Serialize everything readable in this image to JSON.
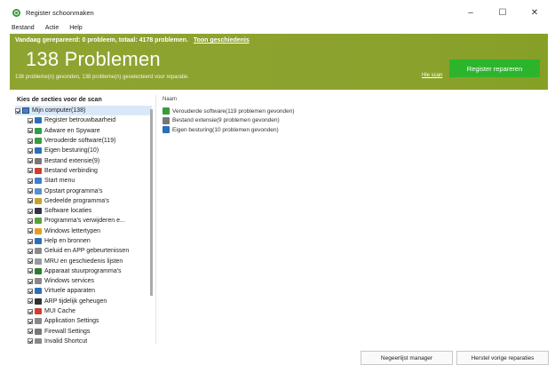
{
  "window": {
    "title": "Register schoonmaken",
    "controls": [
      "–",
      "☐",
      "✕"
    ]
  },
  "menu": [
    "Bestand",
    "Actie",
    "Help"
  ],
  "banner": {
    "summary": "Vandaag gerepareerd: 0 probleem, totaal: 4178 problemen.",
    "history_link": "Toon geschiedenis",
    "headline": "138 Problemen",
    "subtext": "138 probleme(n) gevonden, 138 probleme(n) geselecteerd voor reparatie.",
    "hide_scan": "Hie scan",
    "repair_button": "Register repareren",
    "color": "#8ba22d",
    "button_color": "#2cb52c"
  },
  "left_panel": {
    "header": "Kies de secties voor de scan",
    "root": {
      "label": "Mijn computer(138)",
      "icon": "computer-icon"
    },
    "items": [
      {
        "label": "Register betrouwbaarheid",
        "icon": "registry-icon",
        "color": "#2a6fb8"
      },
      {
        "label": "Adware en Spyware",
        "icon": "adware-icon",
        "color": "#2f9d4a"
      },
      {
        "label": "Verouderde software(119)",
        "icon": "software-icon",
        "color": "#3a9b3a"
      },
      {
        "label": "Eigen besturing(10)",
        "icon": "control-icon",
        "color": "#2a6fb8"
      },
      {
        "label": "Bestand extensie(9)",
        "icon": "file-icon",
        "color": "#777777"
      },
      {
        "label": "Bestand verbinding",
        "icon": "file-link-icon",
        "color": "#d23c2c"
      },
      {
        "label": "Start menu",
        "icon": "start-menu-icon",
        "color": "#3a7fd0"
      },
      {
        "label": "Opstart programma's",
        "icon": "startup-icon",
        "color": "#5a8fc7"
      },
      {
        "label": "Gedeelde programma's",
        "icon": "shared-icon",
        "color": "#c8a030"
      },
      {
        "label": "Software locaties",
        "icon": "location-icon",
        "color": "#334"
      },
      {
        "label": "Programma's verwijderen e...",
        "icon": "uninstall-icon",
        "color": "#5aa03a"
      },
      {
        "label": "Windows lettertypen",
        "icon": "font-icon",
        "color": "#e0a020"
      },
      {
        "label": "Help en bronnen",
        "icon": "help-icon",
        "color": "#2a6fb8"
      },
      {
        "label": "Geluid en APP gebeurtenissen",
        "icon": "sound-icon",
        "color": "#8a8a8a"
      },
      {
        "label": "MRU en geschiedenis lijsten",
        "icon": "history-icon",
        "color": "#999999"
      },
      {
        "label": "Apparaat stuurprogramma's",
        "icon": "driver-icon",
        "color": "#2f7a2f"
      },
      {
        "label": "Windows services",
        "icon": "services-icon",
        "color": "#888888"
      },
      {
        "label": "Virtuele apparaten",
        "icon": "virtual-icon",
        "color": "#2a6fb8"
      },
      {
        "label": "ARP tijdelijk geheugen",
        "icon": "arp-icon",
        "color": "#333333"
      },
      {
        "label": "MUI Cache",
        "icon": "cache-icon",
        "color": "#d23c2c"
      },
      {
        "label": "Application Settings",
        "icon": "app-settings-icon",
        "color": "#888888"
      },
      {
        "label": "Firewall Settings",
        "icon": "firewall-icon",
        "color": "#777777"
      },
      {
        "label": "Invalid Shortcut",
        "icon": "shortcut-icon",
        "color": "#888888"
      }
    ]
  },
  "right_panel": {
    "column_header": "Naam",
    "items": [
      {
        "label": "Verouderde software(119 problemen gevonden)",
        "icon": "software-icon",
        "color": "#3a9b3a"
      },
      {
        "label": "Bestand extensie(9 problemen gevonden)",
        "icon": "file-icon",
        "color": "#777777"
      },
      {
        "label": "Eigen besturing(10 problemen gevonden)",
        "icon": "control-icon",
        "color": "#2a6fb8"
      }
    ]
  },
  "bottom": {
    "ignore_button": "Negeerlijst manager",
    "restore_button": "Herstel vorige reparaties"
  }
}
